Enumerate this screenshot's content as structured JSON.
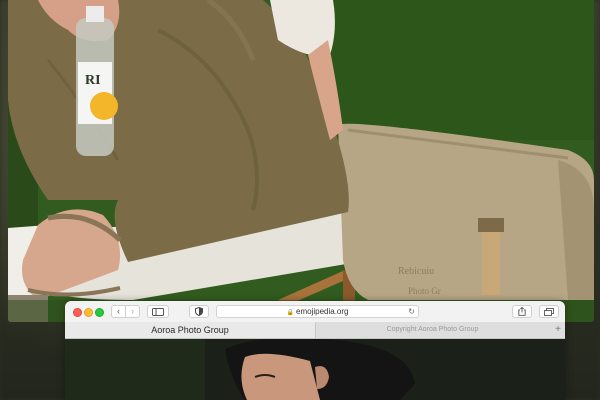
{
  "photo": {
    "bottle_label": "RI",
    "bag_text": "Rebicuiu\nPhoto Gr"
  },
  "browser": {
    "nav": {
      "back_icon": "‹",
      "forward_icon": "›"
    },
    "address": {
      "lock_icon": "🔒",
      "url": "emojipedia.org",
      "reload_icon": "↻"
    },
    "tabs": [
      {
        "label": "Aoroa Photo Group",
        "active": true
      },
      {
        "label": "Copyright Aoroa Photo Group",
        "active": false
      }
    ],
    "new_tab_icon": "+"
  },
  "colors": {
    "close": "#fd5f57",
    "minimize": "#febc2e",
    "maximize": "#28c840",
    "grass": "#2f5a1c",
    "pants": "#7a6b45",
    "bag": "#b9a988"
  }
}
